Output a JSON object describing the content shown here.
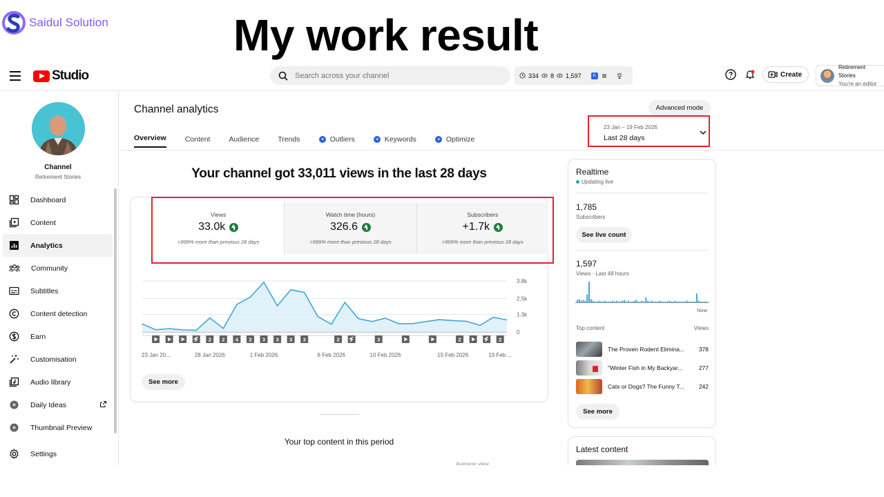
{
  "banner": {
    "brand_name": "Saidul Solution",
    "headline": "My work result"
  },
  "topbar": {
    "app_name": "Studio",
    "search_placeholder": "Search across your channel",
    "stats": {
      "a": "334",
      "b": "8",
      "c": "1,597"
    },
    "create_label": "Create",
    "account_name": "Retirement Stories",
    "account_role": "You're an editor"
  },
  "sidebar": {
    "channel_label": "Channel",
    "channel_name": "Retirement Stories",
    "items": [
      {
        "label": "Dashboard",
        "icon": "dashboard-icon"
      },
      {
        "label": "Content",
        "icon": "content-icon"
      },
      {
        "label": "Analytics",
        "icon": "analytics-icon",
        "active": true
      },
      {
        "label": "Community",
        "icon": "community-icon"
      },
      {
        "label": "Subtitles",
        "icon": "subtitles-icon"
      },
      {
        "label": "Content detection",
        "icon": "copyright-icon"
      },
      {
        "label": "Earn",
        "icon": "dollar-icon"
      },
      {
        "label": "Customisation",
        "icon": "magic-wand-icon"
      },
      {
        "label": "Audio library",
        "icon": "audio-library-icon"
      },
      {
        "label": "Daily Ideas",
        "icon": "extension-icon"
      },
      {
        "label": "Thumbnail Preview",
        "icon": "extension-icon"
      }
    ],
    "settings_label": "Settings"
  },
  "main": {
    "title": "Channel analytics",
    "tabs": [
      "Overview",
      "Content",
      "Audience",
      "Trends",
      "Outliers",
      "Keywords",
      "Optimize"
    ],
    "advanced_mode": "Advanced mode",
    "date_range": "23 Jan – 19 Feb 2026",
    "date_label": "Last 28 days",
    "summary": "Your channel got 33,011 views in the last 28 days",
    "metrics": [
      {
        "label": "Views",
        "value": "33.0k",
        "note": ">999% more than previous 28 days"
      },
      {
        "label": "Watch time (hours)",
        "value": "326.6",
        "note": ">999% more than previous 28 days"
      },
      {
        "label": "Subscribers",
        "value": "+1.7k",
        "note": ">999% more than previous 28 days"
      }
    ],
    "see_more": "See more",
    "top_content_title": "Your top content in this period",
    "avg_view_label": "Average view"
  },
  "chart_data": {
    "type": "area",
    "title": "",
    "ylabel": "",
    "ylim": [
      0,
      3800
    ],
    "y_ticks": [
      "3.8k",
      "2.5k",
      "1.3k",
      "0"
    ],
    "y_tick_values": [
      3800,
      2500,
      1300,
      0
    ],
    "x_tick_labels": [
      "23 Jan 20...",
      "28 Jan 2026",
      "1 Feb 2026",
      "6 Feb 2026",
      "10 Feb 2026",
      "15 Feb 2026",
      "19 Feb ..."
    ],
    "x_tick_days": [
      0,
      5,
      9,
      14,
      18,
      23,
      26.5
    ],
    "days": [
      0,
      1,
      2,
      3,
      4,
      5,
      6,
      7,
      8,
      9,
      10,
      11,
      12,
      13,
      14,
      15,
      16,
      17,
      18,
      19,
      20,
      21,
      22,
      23,
      24,
      25,
      26,
      27
    ],
    "values": [
      600,
      170,
      250,
      160,
      130,
      1050,
      270,
      2050,
      2600,
      3700,
      1950,
      3150,
      2950,
      1150,
      580,
      2200,
      1000,
      780,
      1030,
      620,
      620,
      780,
      920,
      850,
      800,
      500,
      1100,
      900
    ],
    "markers": [
      {
        "day": 1,
        "kind": "video"
      },
      {
        "day": 2,
        "kind": "video"
      },
      {
        "day": 3,
        "kind": "video"
      },
      {
        "day": 4,
        "kind": "short"
      },
      {
        "day": 5,
        "kind": "2"
      },
      {
        "day": 6,
        "kind": "2"
      },
      {
        "day": 7,
        "kind": "4"
      },
      {
        "day": 8,
        "kind": "2"
      },
      {
        "day": 9,
        "kind": "3"
      },
      {
        "day": 10,
        "kind": "3"
      },
      {
        "day": 11,
        "kind": "3"
      },
      {
        "day": 12,
        "kind": "3"
      },
      {
        "day": 14.5,
        "kind": "2"
      },
      {
        "day": 15.5,
        "kind": "short"
      },
      {
        "day": 17.5,
        "kind": "3"
      },
      {
        "day": 19.5,
        "kind": "video"
      },
      {
        "day": 21.5,
        "kind": "video"
      },
      {
        "day": 23.5,
        "kind": "2"
      },
      {
        "day": 24.5,
        "kind": "video"
      },
      {
        "day": 25.5,
        "kind": "short"
      },
      {
        "day": 26.5,
        "kind": "2"
      }
    ],
    "colors": {
      "line": "#3ea6d8",
      "fill": "#dbeef8",
      "marker": "#606060"
    }
  },
  "realtime": {
    "title": "Realtime",
    "status": "Updating live",
    "subscribers_value": "1,785",
    "subscribers_label": "Subscribers",
    "see_live_count": "See live count",
    "views_value": "1,597",
    "views_label": "Views · Last 48 hours",
    "now_label": "Now",
    "bars": [
      3,
      4,
      2,
      3,
      2,
      10,
      26,
      4,
      2,
      1,
      1,
      2,
      1,
      1,
      2,
      1,
      1,
      1,
      2,
      1,
      2,
      1,
      1,
      2,
      3,
      1,
      2,
      1,
      1,
      2,
      3,
      1,
      1,
      2,
      1,
      6,
      2,
      1,
      2,
      1,
      1,
      1,
      2,
      1,
      1,
      1,
      1,
      2,
      1,
      1,
      2,
      1,
      1,
      1,
      1,
      1,
      2,
      1,
      1,
      1,
      1,
      11,
      2,
      1,
      1,
      1,
      1
    ],
    "top_content_label": "Top content",
    "views_col_label": "Views",
    "top_content": [
      {
        "title": "The Proven Rodent Elimina...",
        "views": "378"
      },
      {
        "title": "\"Winter Fish in My Backyar...",
        "views": "277"
      },
      {
        "title": "Cats or Dogs? The Funny T...",
        "views": "242"
      }
    ],
    "see_more": "See more"
  },
  "latest": {
    "title": "Latest content"
  },
  "colors": {
    "accent_red": "#e5202e",
    "brand_purple": "#7c5cff",
    "positive_green": "#1a7f37",
    "link_blue": "#3361e0"
  }
}
